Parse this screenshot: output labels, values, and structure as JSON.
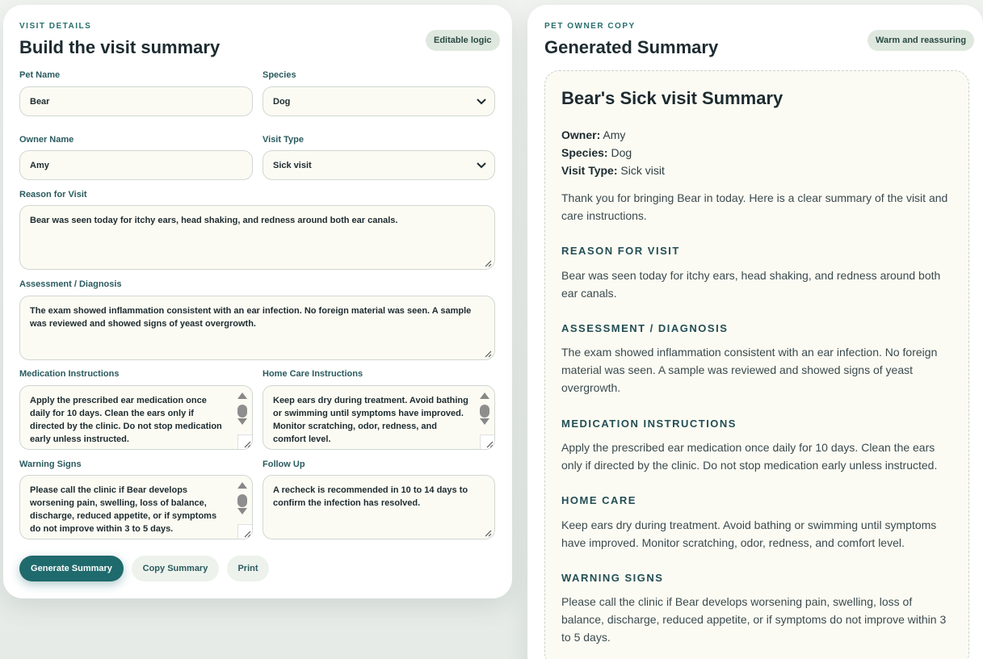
{
  "form": {
    "eyebrow": "VISIT DETAILS",
    "title": "Build the visit summary",
    "badge": "Editable logic",
    "pet_name": {
      "label": "Pet Name",
      "value": "Bear"
    },
    "species": {
      "label": "Species",
      "value": "Dog"
    },
    "owner_name": {
      "label": "Owner Name",
      "value": "Amy"
    },
    "visit_type": {
      "label": "Visit Type",
      "value": "Sick visit"
    },
    "reason": {
      "label": "Reason for Visit",
      "value": "Bear was seen today for itchy ears, head shaking, and redness around both ear canals."
    },
    "assessment": {
      "label": "Assessment / Diagnosis",
      "value": "The exam showed inflammation consistent with an ear infection. No foreign material was seen. A sample was reviewed and showed signs of yeast overgrowth."
    },
    "medication": {
      "label": "Medication Instructions",
      "value": "Apply the prescribed ear medication once daily for 10 days. Clean the ears only if directed by the clinic. Do not stop medication early unless instructed."
    },
    "home_care": {
      "label": "Home Care Instructions",
      "value": "Keep ears dry during treatment. Avoid bathing or swimming until symptoms have improved. Monitor scratching, odor, redness, and comfort level."
    },
    "warning": {
      "label": "Warning Signs",
      "value": "Please call the clinic if Bear develops worsening pain, swelling, loss of balance, discharge, reduced appetite, or if symptoms do not improve within 3 to 5 days."
    },
    "follow_up": {
      "label": "Follow Up",
      "value": "A recheck is recommended in 10 to 14 days to confirm the infection has resolved."
    },
    "buttons": {
      "generate": "Generate Summary",
      "copy": "Copy Summary",
      "print": "Print"
    }
  },
  "summary": {
    "eyebrow": "PET OWNER COPY",
    "title": "Generated Summary",
    "badge": "Warm and reassuring",
    "heading": "Bear's Sick visit Summary",
    "owner_label": "Owner:",
    "owner_value": "Amy",
    "species_label": "Species:",
    "species_value": "Dog",
    "visit_label": "Visit Type:",
    "visit_value": "Sick visit",
    "intro": "Thank you for bringing Bear in today. Here is a clear summary of the visit and care instructions.",
    "sections": [
      {
        "heading": "REASON FOR VISIT",
        "text": "Bear was seen today for itchy ears, head shaking, and redness around both ear canals."
      },
      {
        "heading": "ASSESSMENT / DIAGNOSIS",
        "text": "The exam showed inflammation consistent with an ear infection. No foreign material was seen. A sample was reviewed and showed signs of yeast overgrowth."
      },
      {
        "heading": "MEDICATION INSTRUCTIONS",
        "text": "Apply the prescribed ear medication once daily for 10 days. Clean the ears only if directed by the clinic. Do not stop medication early unless instructed."
      },
      {
        "heading": "HOME CARE",
        "text": "Keep ears dry during treatment. Avoid bathing or swimming until symptoms have improved. Monitor scratching, odor, redness, and comfort level."
      },
      {
        "heading": "WARNING SIGNS",
        "text": "Please call the clinic if Bear develops worsening pain, swelling, loss of balance, discharge, reduced appetite, or if symptoms do not improve within 3 to 5 days."
      }
    ]
  },
  "colors": {
    "primary": "#1f6a6c",
    "accent_text": "#2a6e6e",
    "field_bg": "#fcfbf3",
    "badge_bg": "#dfe8df"
  },
  "icons": {
    "select_arrow": "chevron-down-icon",
    "resize": "resize-handle-icon"
  }
}
